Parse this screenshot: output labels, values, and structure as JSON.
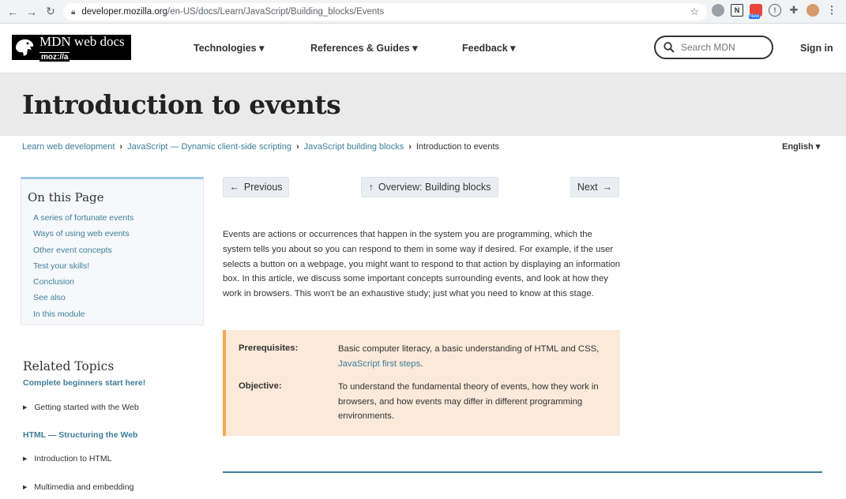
{
  "browser": {
    "url_domain": "developer.mozilla.org",
    "url_path": "/en-US/docs/Learn/JavaScript/Building_blocks/Events",
    "ext_badge": "New"
  },
  "header": {
    "logo_line1": "MDN web docs",
    "logo_line2": "moz://a",
    "nav": [
      "Technologies ▾",
      "References & Guides ▾",
      "Feedback ▾"
    ],
    "search_placeholder": "Search MDN",
    "signin": "Sign in"
  },
  "page": {
    "title": "Introduction to events",
    "breadcrumbs": [
      "Learn web development",
      "JavaScript — Dynamic client-side scripting",
      "JavaScript building blocks"
    ],
    "breadcrumb_current": "Introduction to events",
    "language": "English ▾"
  },
  "toc": {
    "title": "On this Page",
    "items": [
      "A series of fortunate events",
      "Ways of using web events",
      "Other event concepts",
      "Test your skills!",
      "Conclusion",
      "See also",
      "In this module"
    ]
  },
  "related": {
    "title": "Related Topics",
    "sub1": "Complete beginners start here!",
    "item1": "Getting started with the Web",
    "sub2": "HTML — Structuring the Web",
    "item2": "Introduction to HTML",
    "item3": "Multimedia and embedding"
  },
  "pager": {
    "previous": "Previous",
    "overview": "Overview: Building blocks",
    "next": "Next"
  },
  "article": {
    "intro": "Events are actions or occurrences that happen in the system you are programming, which the system tells you about so you can respond to them in some way if desired. For example, if the user selects a button on a webpage, you might want to respond to that action by displaying an information box. In this article, we discuss some important concepts surrounding events, and look at how they work in browsers. This won't be an exhaustive study; just what you need to know at this stage.",
    "prereq_label": "Prerequisites:",
    "prereq_text": "Basic computer literacy, a basic understanding of HTML and CSS,",
    "prereq_link": "JavaScript first steps",
    "prereq_end": ".",
    "objective_label": "Objective:",
    "objective_text": "To understand the fundamental theory of events, how they work in browsers, and how events may differ in different programming environments."
  }
}
